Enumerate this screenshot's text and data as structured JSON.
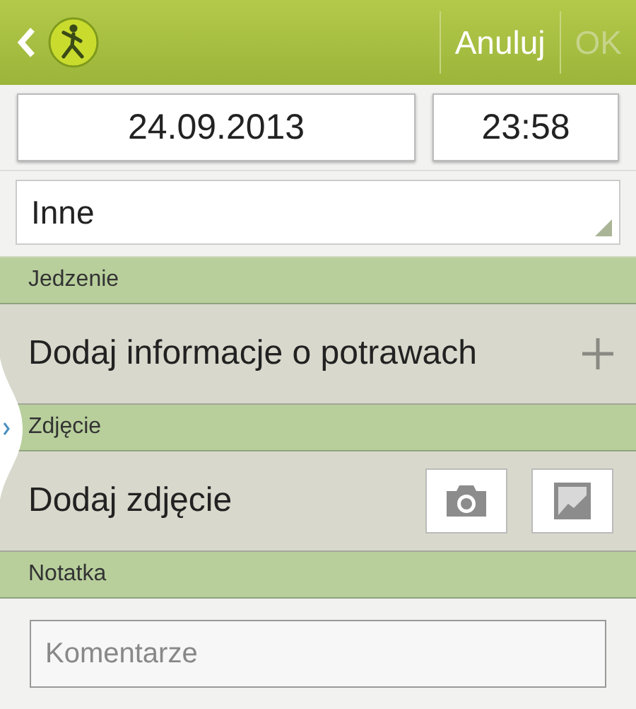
{
  "action_bar": {
    "cancel": "Anuluj",
    "ok": {
      "label": "OK",
      "disabled": true
    }
  },
  "date": "24.09.2013",
  "time": "23:58",
  "category": "Inne",
  "sections": [
    {
      "kind": "add",
      "title": "Jedzenie",
      "label": "Dodaj informacje o potrawach"
    },
    {
      "kind": "photo",
      "title": "Zdjęcie",
      "label": "Dodaj zdjęcie"
    },
    {
      "kind": "note",
      "title": "Notatka",
      "placeholder": "Komentarze"
    }
  ]
}
